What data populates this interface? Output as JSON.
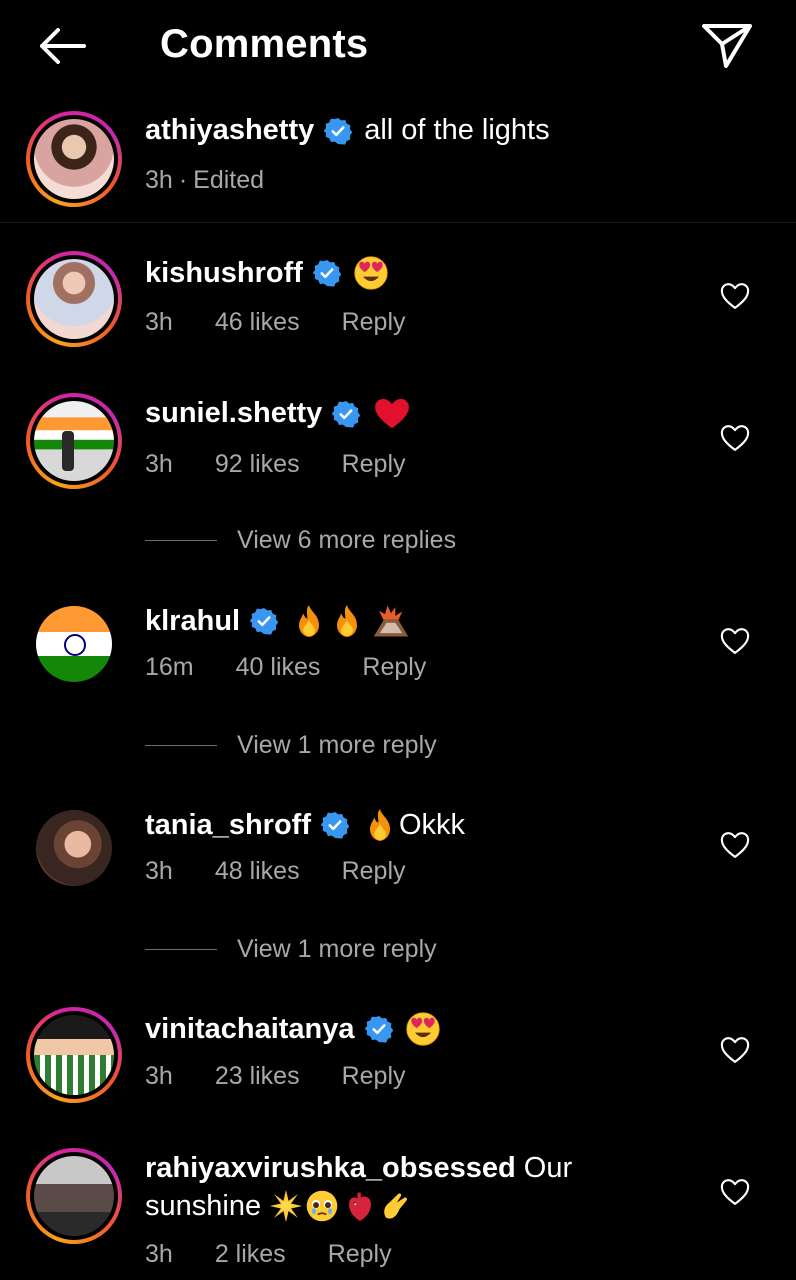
{
  "header": {
    "title": "Comments",
    "back_icon": "arrow-left-icon",
    "share_icon": "paper-plane-icon"
  },
  "caption": {
    "username": "athiyashetty",
    "text": "all of the lights",
    "time": "3h",
    "edited": "Edited",
    "separator": "·"
  },
  "comments": [
    {
      "username": "kishushroff",
      "emoji": "heart-eyes",
      "time": "3h",
      "likes": "46 likes",
      "reply": "Reply"
    },
    {
      "username": "suniel.shetty",
      "emoji": "red-heart",
      "time": "3h",
      "likes": "92 likes",
      "reply": "Reply",
      "view_replies": "View 6 more replies"
    },
    {
      "username": "klrahul",
      "emoji": "fire fire volcano",
      "time": "16m",
      "likes": "40 likes",
      "reply": "Reply",
      "view_replies": "View 1 more reply"
    },
    {
      "username": "tania_shroff",
      "emoji": "fire",
      "text": "Okkk",
      "time": "3h",
      "likes": "48 likes",
      "reply": "Reply",
      "view_replies": "View 1 more reply"
    },
    {
      "username": "vinitachaitanya",
      "emoji": "heart-eyes",
      "time": "3h",
      "likes": "23 likes",
      "reply": "Reply"
    },
    {
      "username": "rahiyaxvirushka_obsessed",
      "text": "Our",
      "text2": "sunshine",
      "emoji": "sun pleading anatomical-heart pinching-hand",
      "time": "3h",
      "likes": "2 likes",
      "reply": "Reply"
    }
  ],
  "colors": {
    "background": "#000000",
    "text": "#ffffff",
    "secondary": "#a8a8a8",
    "verified": "#3897f0"
  }
}
